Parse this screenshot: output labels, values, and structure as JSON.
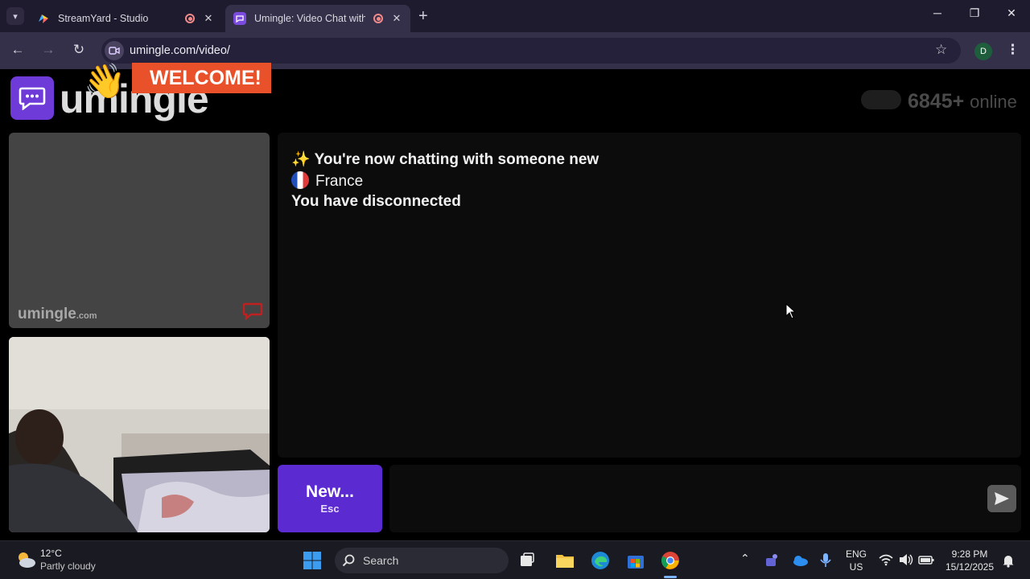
{
  "browser": {
    "tabs": [
      {
        "title": "StreamYard - Studio",
        "active": false
      },
      {
        "title": "Umingle: Video Chat with Sti",
        "active": true
      }
    ],
    "url": "umingle.com/video/",
    "profile_initial": "D"
  },
  "site": {
    "logo_text": "umingle",
    "welcome_banner": "WELCOME!",
    "online_count": "6845+",
    "online_label": "online",
    "watermark": "umingle",
    "watermark_suffix": ".com"
  },
  "chat": {
    "messages": [
      {
        "icon": "sparkles",
        "text": "✨ You're now chatting with someone new"
      },
      {
        "icon": "france-flag",
        "text": "France"
      },
      {
        "text": "You have disconnected"
      }
    ],
    "new_button_label": "New...",
    "new_button_shortcut": "Esc",
    "input_value": ""
  },
  "taskbar": {
    "temperature": "12°C",
    "weather": "Partly cloudy",
    "search_placeholder": "Search",
    "language": "ENG",
    "region": "US",
    "time": "9:28 PM",
    "date": "15/12/2025"
  },
  "colors": {
    "accent": "#5b2bd1",
    "logo_bg": "#6e3ad8",
    "welcome_bg": "#e8512a",
    "chrome_bg": "#1f1b2e",
    "chrome_toolbar": "#35304a"
  }
}
